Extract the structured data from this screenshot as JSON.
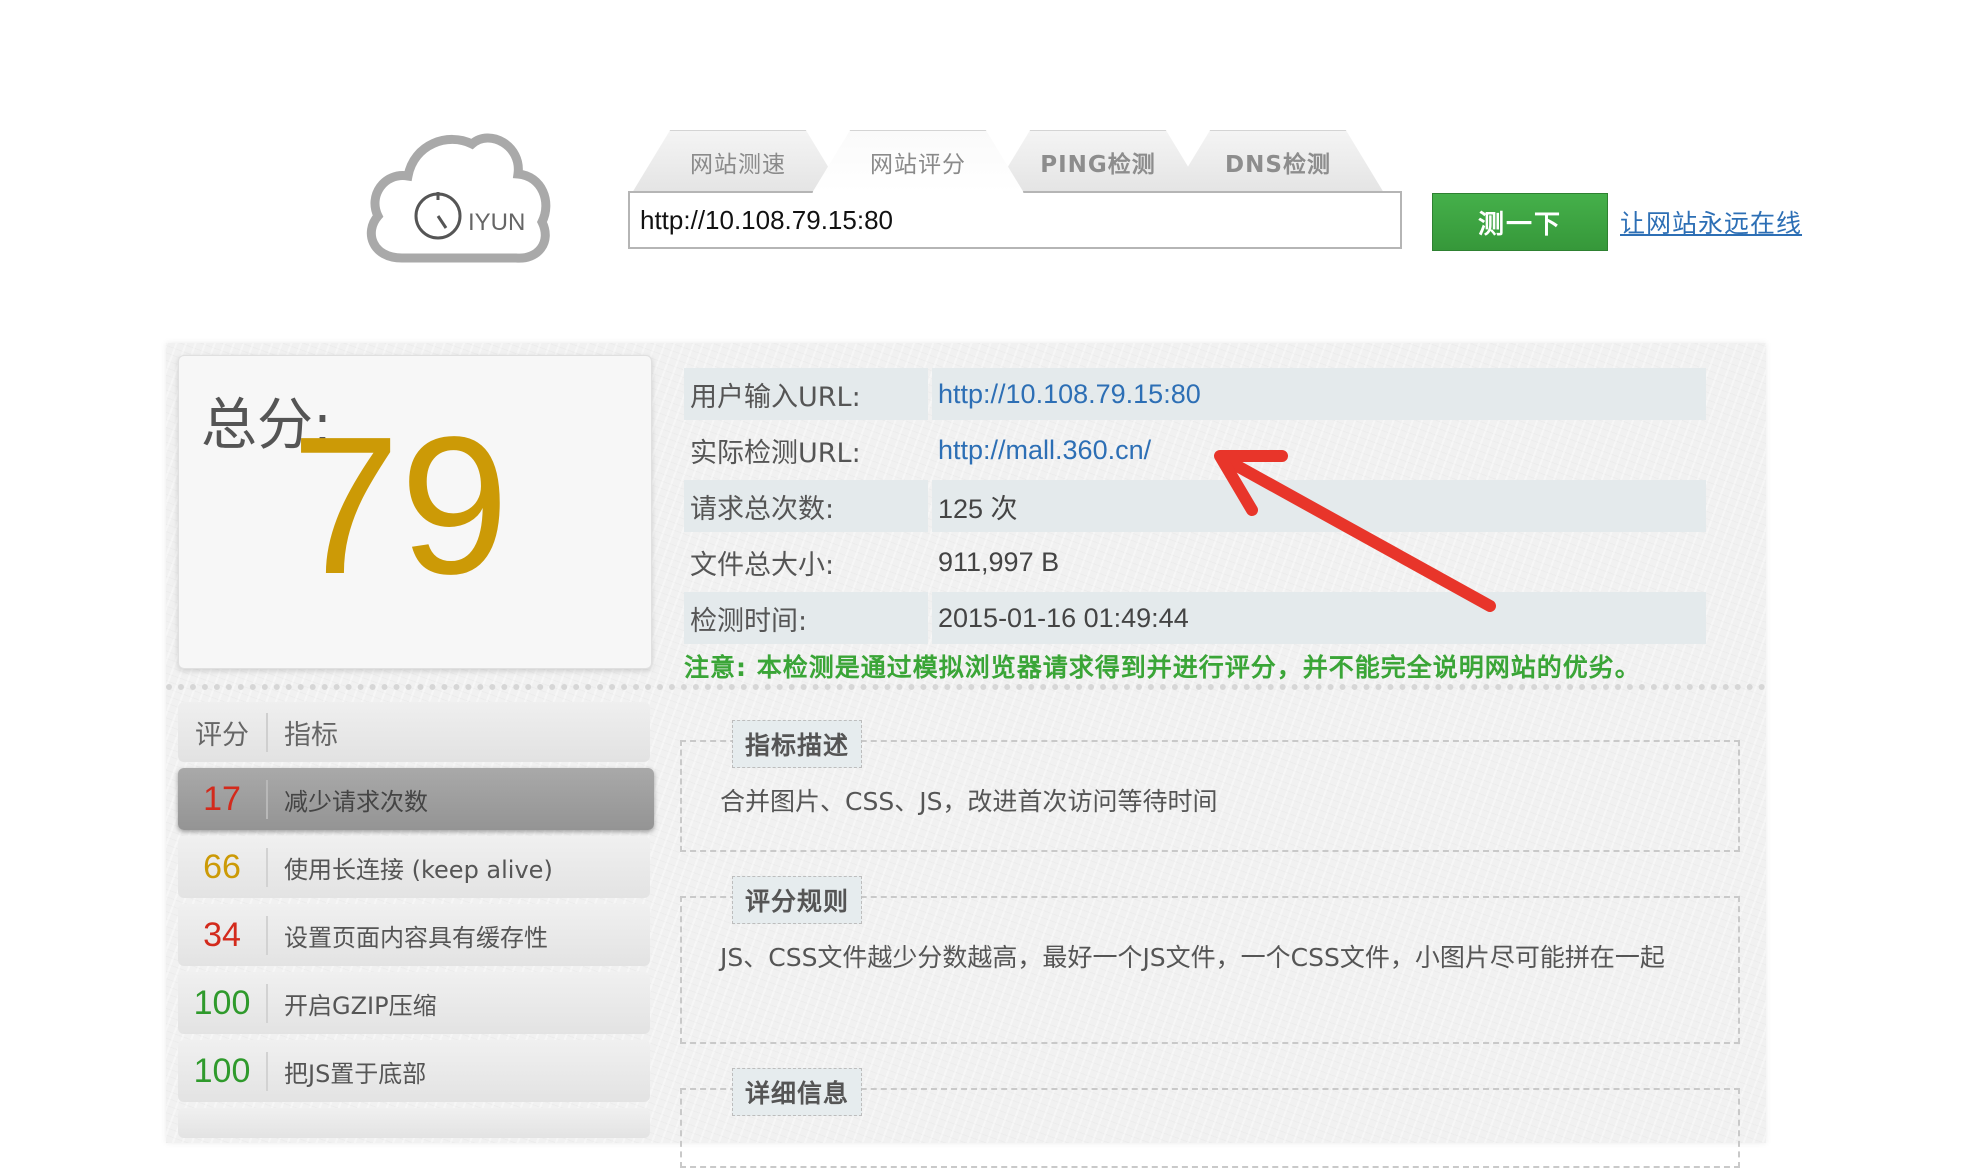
{
  "logo": {
    "text": "IYUN"
  },
  "tabs": [
    {
      "label": "网站测速",
      "active": false
    },
    {
      "label": "网站评分",
      "active": true
    },
    {
      "label": "PING检测",
      "active": false
    },
    {
      "label": "DNS检测",
      "active": false
    }
  ],
  "search": {
    "value": "http://10.108.79.15:80",
    "button": "测一下",
    "promo": "让网站永远在线"
  },
  "score": {
    "label": "总分:",
    "value": "79"
  },
  "info": [
    {
      "key": "用户输入URL:",
      "value": "http://10.108.79.15:80"
    },
    {
      "key": "实际检测URL:",
      "value": "http://mall.360.cn/"
    },
    {
      "key": "请求总次数:",
      "value": "125 次"
    },
    {
      "key": "文件总大小:",
      "value": "911,997 B"
    },
    {
      "key": "检测时间:",
      "value": "2015-01-16 01:49:44"
    }
  ],
  "notice": "注意: 本检测是通过模拟浏览器请求得到并进行评分，并不能完全说明网站的优劣。",
  "metrics_header": {
    "score": "评分",
    "metric": "指标"
  },
  "metrics": [
    {
      "score": "17",
      "name": "减少请求次数",
      "color": "#d32a1c"
    },
    {
      "score": "66",
      "name": "使用长连接 (keep alive)",
      "color": "#cc9a06"
    },
    {
      "score": "34",
      "name": "设置页面内容具有缓存性",
      "color": "#d32a1c"
    },
    {
      "score": "100",
      "name": "开启GZIP压缩",
      "color": "#2f9a2c"
    },
    {
      "score": "100",
      "name": "把JS置于底部",
      "color": "#2f9a2c"
    }
  ],
  "sections": [
    {
      "title": "指标描述",
      "body": "合并图片、CSS、JS，改进首次访问等待时间"
    },
    {
      "title": "评分规则",
      "body": "JS、CSS文件越少分数越高，最好一个JS文件，一个CSS文件，小图片尽可能拼在一起"
    },
    {
      "title": "详细信息",
      "body": ""
    }
  ],
  "colors": {
    "accent_green": "#3aa537",
    "score_gold": "#cc9a06",
    "link_blue": "#2d6fb5",
    "arrow_red": "#e8352a"
  }
}
